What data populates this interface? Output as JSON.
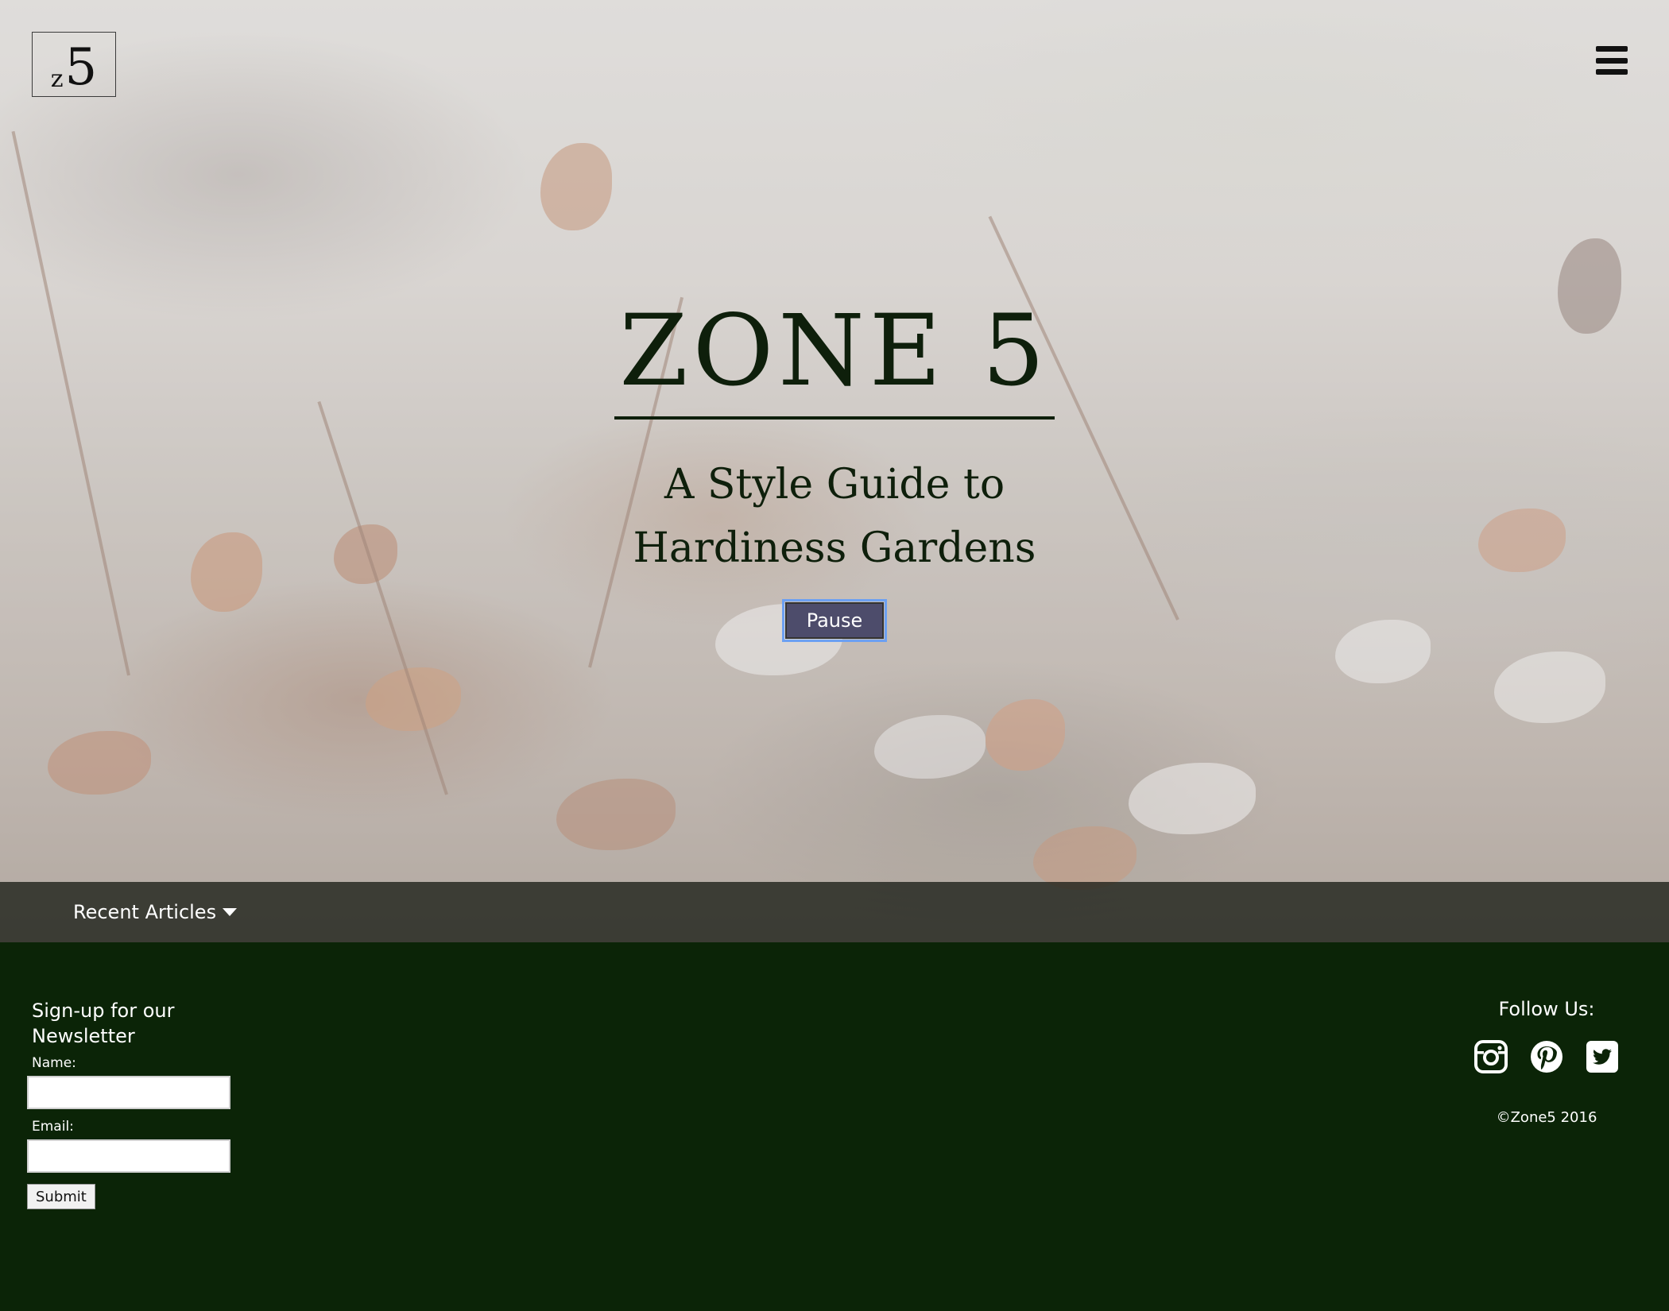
{
  "header": {
    "logo_letter": "z",
    "logo_number": "5"
  },
  "hero": {
    "title": "ZONE 5",
    "subtitle_line1": "A Style Guide to",
    "subtitle_line2": "Hardiness Gardens",
    "pause_label": "Pause"
  },
  "articles_bar": {
    "label": "Recent Articles"
  },
  "footer": {
    "signup": {
      "heading_line1": "Sign-up for our",
      "heading_line2": "Newsletter",
      "name_label": "Name:",
      "email_label": "Email:",
      "submit_label": "Submit"
    },
    "follow": {
      "heading": "Follow Us:",
      "icons": [
        "instagram-icon",
        "pinterest-icon",
        "twitter-icon"
      ]
    },
    "copyright": "©Zone5 2016"
  },
  "colors": {
    "footer_bg": "#0b2407",
    "pause_bg": "#4d4c6b",
    "pause_focus": "#6ca0f2",
    "title_color": "#0e1f0b"
  }
}
